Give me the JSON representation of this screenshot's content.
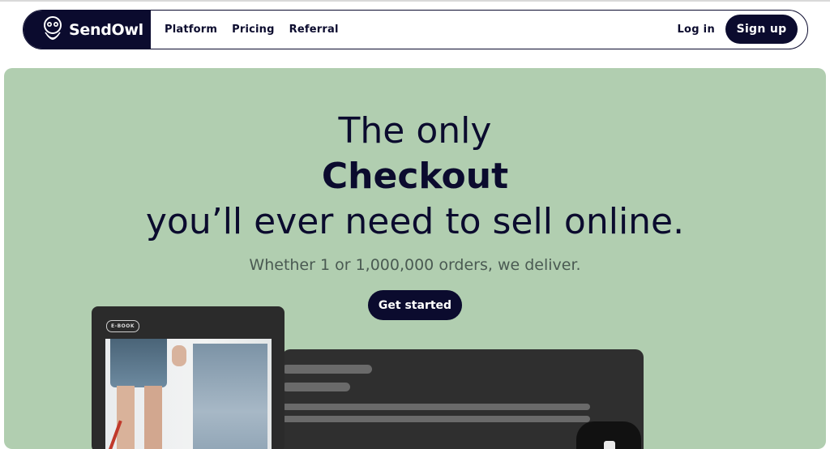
{
  "nav": {
    "brand": "SendOwl",
    "links": [
      "Platform",
      "Pricing",
      "Referral"
    ],
    "login": "Log in",
    "signup": "Sign up"
  },
  "hero": {
    "line1": "The only",
    "line2": "Checkout",
    "line3": "you’ll ever need to sell online.",
    "subtitle": "Whether 1 or 1,000,000 orders, we deliver.",
    "cta": "Get started"
  },
  "mockup": {
    "tag": "E-BOOK"
  },
  "colors": {
    "navy": "#0b0b2e",
    "hero_bg": "#b1ceb0",
    "white": "#ffffff"
  },
  "icons": {
    "logo": "owl-logo-icon"
  }
}
